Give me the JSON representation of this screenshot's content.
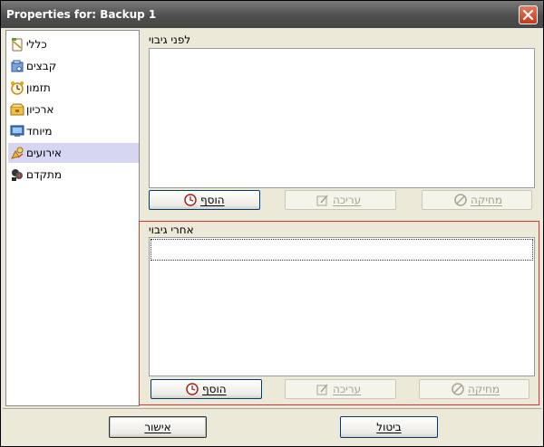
{
  "window": {
    "title": "Properties for: Backup 1"
  },
  "nav": {
    "items": [
      {
        "label": "כללי",
        "icon": "general-icon",
        "selected": false
      },
      {
        "label": "קבצים",
        "icon": "files-icon",
        "selected": false
      },
      {
        "label": "תזמון",
        "icon": "schedule-icon",
        "selected": false
      },
      {
        "label": "ארכיון",
        "icon": "archive-icon",
        "selected": false
      },
      {
        "label": "מיוחד",
        "icon": "special-icon",
        "selected": false
      },
      {
        "label": "אירועים",
        "icon": "events-icon",
        "selected": true
      },
      {
        "label": "מתקדם",
        "icon": "advanced-icon",
        "selected": false
      }
    ]
  },
  "before_backup": {
    "label": "לפני גיבוי",
    "add_label": "הוסף",
    "edit_label": "עריכה",
    "delete_label": "מחיקה"
  },
  "after_backup": {
    "label": "אחרי גיבוי",
    "add_label": "הוסף",
    "edit_label": "עריכה",
    "delete_label": "מחיקה"
  },
  "footer": {
    "ok_label": "אישור",
    "cancel_label": "ביטול"
  },
  "colors": {
    "selection": "#d6d5f2",
    "focus_border": "#d93636",
    "titlebar": "#4f4f4f",
    "close": "#c4391c"
  }
}
